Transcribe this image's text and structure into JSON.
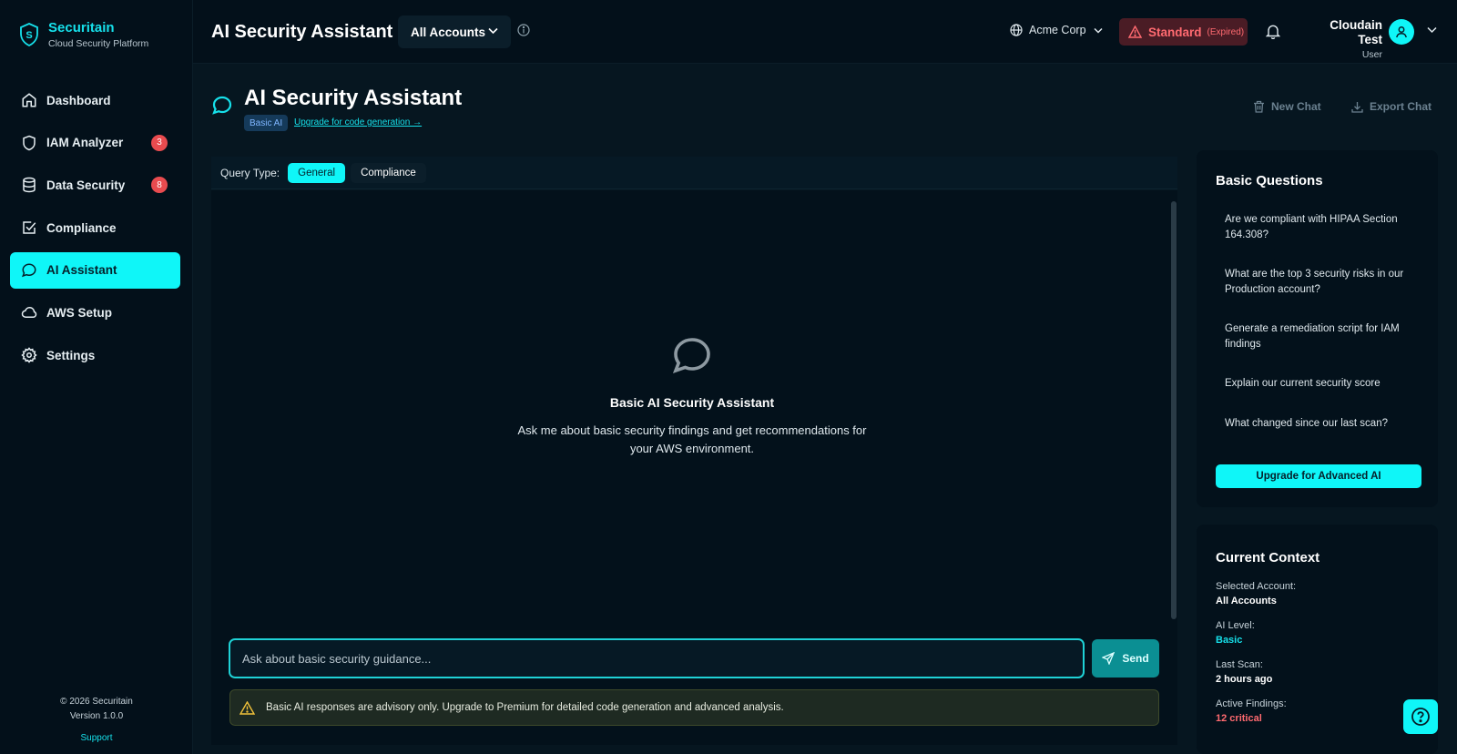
{
  "sidebar": {
    "brand_name": "Securitain",
    "brand_sub": "Cloud Security Platform",
    "items": [
      {
        "label": "Dashboard",
        "icon": "home-icon"
      },
      {
        "label": "IAM Analyzer",
        "icon": "shield-icon",
        "badge": "3"
      },
      {
        "label": "Data Security",
        "icon": "database-icon",
        "badge": "8"
      },
      {
        "label": "Compliance",
        "icon": "checkbox-icon"
      },
      {
        "label": "AI Assistant",
        "icon": "chat-icon",
        "active": true
      },
      {
        "label": "AWS Setup",
        "icon": "cloud-icon"
      },
      {
        "label": "Settings",
        "icon": "gear-icon"
      }
    ],
    "footer": {
      "copyright": "© 2026 Securitain",
      "version": "Version 1.0.0",
      "support": "Support"
    }
  },
  "topbar": {
    "title": "AI Security Assistant",
    "account_select": "All Accounts",
    "org": "Acme Corp",
    "plan": "Standard",
    "plan_status": "(Expired)",
    "user_name": "Cloudain Test",
    "user_role": "User"
  },
  "page": {
    "title": "AI Security Assistant",
    "tier_badge": "Basic AI",
    "upgrade_link": "Upgrade for code generation →",
    "new_chat": "New Chat",
    "export_chat": "Export Chat"
  },
  "chat": {
    "query_type_label": "Query Type:",
    "query_types": [
      "General",
      "Compliance"
    ],
    "active_query_type": "General",
    "empty_title": "Basic AI Security Assistant",
    "empty_desc": "Ask me about basic security findings and get recommendations for your AWS environment.",
    "input_placeholder": "Ask about basic security guidance...",
    "send_label": "Send",
    "advisory": "Basic AI responses are advisory only. Upgrade to Premium for detailed code generation and advanced analysis."
  },
  "basic_questions": {
    "title": "Basic Questions",
    "items": [
      "Are we compliant with HIPAA Section 164.308?",
      "What are the top 3 security risks in our Production account?",
      "Generate a remediation script for IAM findings",
      "Explain our current security score",
      "What changed since our last scan?"
    ],
    "upgrade_button": "Upgrade for Advanced AI"
  },
  "context": {
    "title": "Current Context",
    "selected_account_label": "Selected Account:",
    "selected_account": "All Accounts",
    "ai_level_label": "AI Level:",
    "ai_level": "Basic",
    "last_scan_label": "Last Scan:",
    "last_scan": "2 hours ago",
    "active_findings_label": "Active Findings:",
    "active_findings": "12 critical"
  },
  "colors": {
    "accent": "#0ff6f8",
    "danger": "#e94b4f",
    "background": "#061620",
    "sidebar": "#03101a"
  }
}
